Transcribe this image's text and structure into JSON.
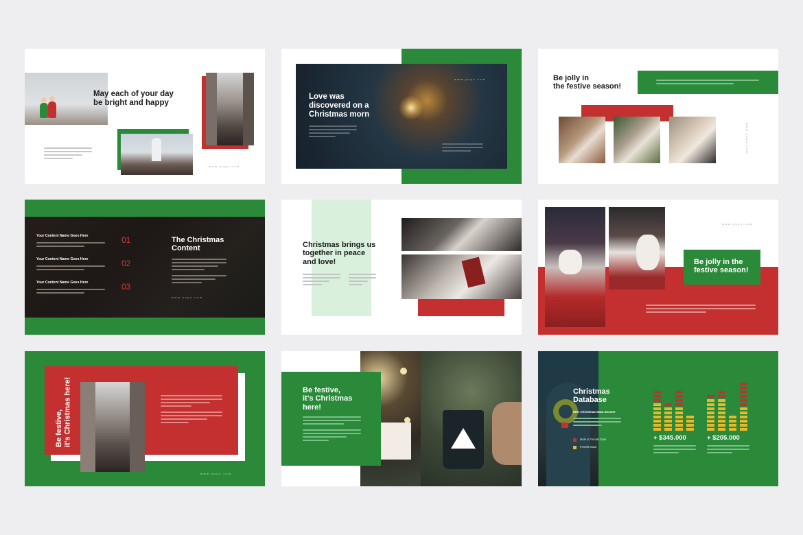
{
  "colors": {
    "green": "#2a8a3a",
    "red": "#c4302f",
    "bg": "#eeeef0",
    "dark": "#1d2a33",
    "mint": "#d9f1dc",
    "yellow": "#e8b92a"
  },
  "slide1": {
    "title": "May each of your day\nbe bright and happy",
    "website": "www.yoyo.com"
  },
  "slide2": {
    "title": "Love was\ndiscovered on a\nChristmas morn",
    "website": "www.yoyo.com"
  },
  "slide3": {
    "title": "Be jolly in\nthe festive season!",
    "website": "www.yoyo.com"
  },
  "slide4": {
    "title": "The Christmas\nContent",
    "website": "www.yoyo.com",
    "items": [
      {
        "heading": "Your Content Name Goes Here",
        "number": "01"
      },
      {
        "heading": "Your Content Name Goes Here",
        "number": "02"
      },
      {
        "heading": "Your Content Name Goes Here",
        "number": "03"
      }
    ]
  },
  "slide5": {
    "title": "Christmas brings us\ntogether in peace\nand love!"
  },
  "slide6": {
    "title": "Be jolly in the\nfestive season!",
    "website": "www.yoyo.com"
  },
  "slide7": {
    "title": "Be festive,\nit's Christmas here!",
    "website": "www.yoyo.com"
  },
  "slide8": {
    "title": "Be festive,\nit's Christmas\nhere!"
  },
  "slide9": {
    "title": "Christmas\nDatabase",
    "subtitle": "65% Christmas Data Income",
    "legend": [
      "Male & Female Data",
      "Female Data"
    ],
    "values": [
      "+ $345.000",
      "+ $205.000"
    ]
  }
}
